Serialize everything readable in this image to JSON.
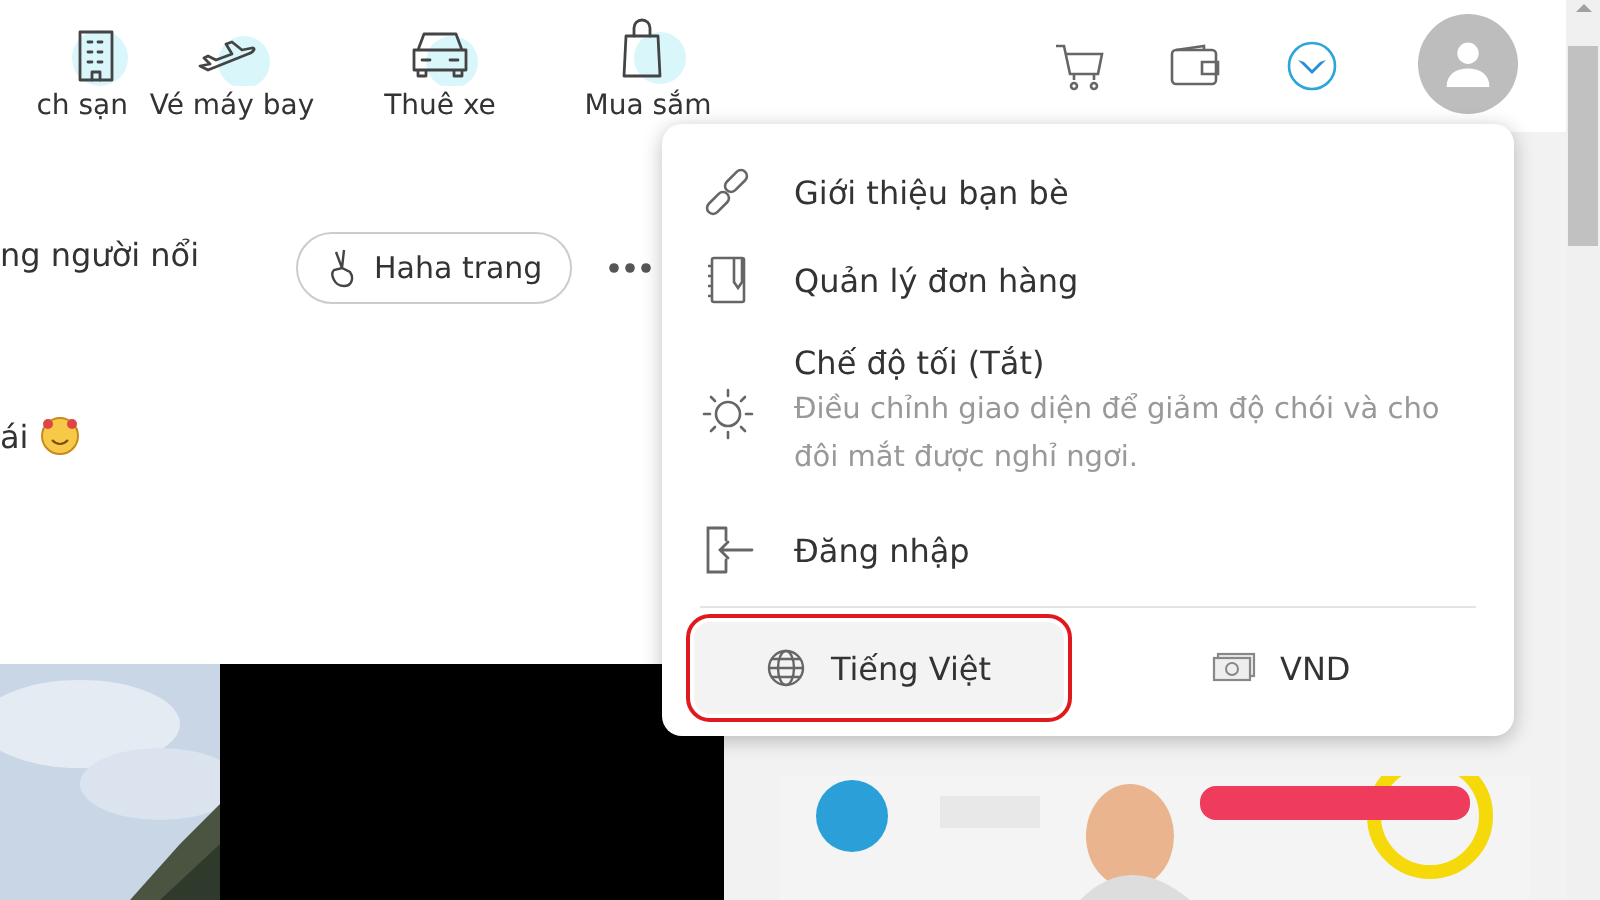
{
  "nav": {
    "items": [
      {
        "kind": "hotel",
        "label": "ch sạn"
      },
      {
        "kind": "flight",
        "label": "Vé máy bay"
      },
      {
        "kind": "car",
        "label": "Thuê xe"
      },
      {
        "kind": "shop",
        "label": "Mua sắm"
      }
    ]
  },
  "post": {
    "text_line_1": "ng người nổi",
    "follow_button": "Haha trang",
    "text_line_2": "ái"
  },
  "menu": {
    "items": [
      {
        "kind": "link",
        "label": "Giới thiệu bạn bè"
      },
      {
        "kind": "orders",
        "label": "Quản lý đơn hàng"
      },
      {
        "kind": "theme",
        "label": "Chế độ tối (Tắt)",
        "description": "Điều chỉnh giao diện để giảm độ chói và cho đôi mắt được nghỉ ngơi."
      },
      {
        "kind": "login",
        "label": "Đăng nhập"
      }
    ],
    "language": {
      "label": "Tiếng Việt",
      "highlighted": true
    },
    "currency": {
      "label": "VND"
    }
  }
}
